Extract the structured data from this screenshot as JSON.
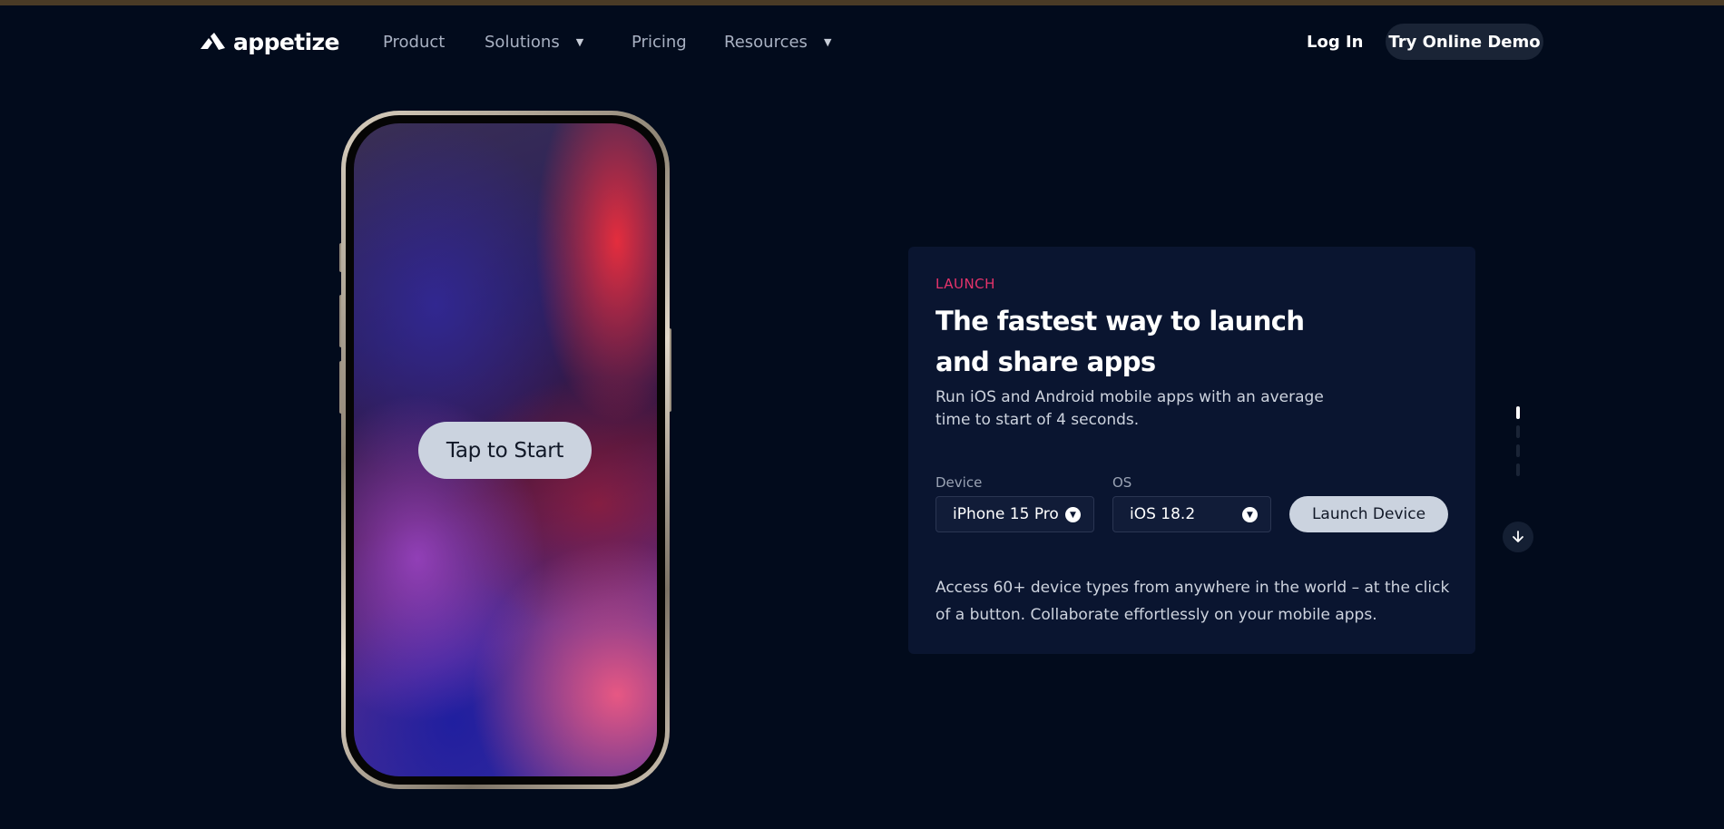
{
  "nav": {
    "logo_text": "appetize",
    "links": [
      {
        "label": "Product",
        "has_caret": false
      },
      {
        "label": "Solutions",
        "has_caret": true
      },
      {
        "label": "Pricing",
        "has_caret": false
      },
      {
        "label": "Resources",
        "has_caret": true
      }
    ],
    "login_label": "Log In",
    "demo_label": "Try Online Demo"
  },
  "phone": {
    "tap_label": "Tap to Start"
  },
  "card": {
    "eyebrow": "LAUNCH",
    "headline": "The fastest way to launch and share apps",
    "subtitle": "Run iOS and Android mobile apps with an average time to start of 4 seconds.",
    "device_label": "Device",
    "device_value": "iPhone 15 Pro",
    "os_label": "OS",
    "os_value": "iOS 18.2",
    "launch_label": "Launch Device",
    "description": "Access 60+ device types from anywhere in the world – at the click of a button. Collaborate effortlessly on your mobile apps."
  },
  "scroll_indicator": {
    "total": 4,
    "active": 1
  },
  "colors": {
    "background": "#020b1c",
    "card": "#0a1530",
    "accent": "#e6336b",
    "button_light": "#cbd3df"
  },
  "icons": {
    "logo": "appetize-logo-icon",
    "caret": "caret-down-icon",
    "select": "chevron-circle-down-icon",
    "scroll": "arrow-down-icon"
  }
}
